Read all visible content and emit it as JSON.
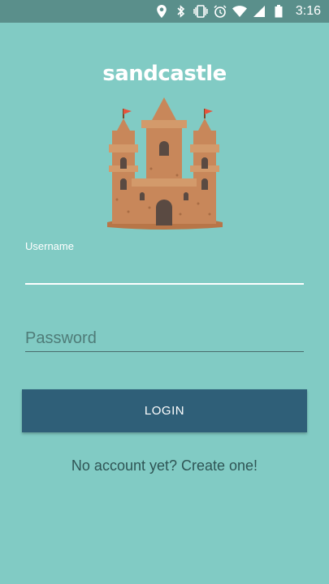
{
  "status_bar": {
    "time": "3:16",
    "icons": [
      "location-icon",
      "bluetooth-icon",
      "vibrate-icon",
      "alarm-icon",
      "wifi-icon",
      "signal-icon",
      "battery-icon"
    ]
  },
  "app": {
    "title": "sandcastle",
    "logo": "sandcastle-logo"
  },
  "form": {
    "username_label": "Username",
    "username_value": "",
    "password_placeholder": "Password",
    "password_value": "",
    "login_label": "LOGIN",
    "signup_text": "No account yet? Create one!"
  },
  "colors": {
    "background": "#81cbc4",
    "status_bar": "#5a8f8b",
    "button": "#2f5f78",
    "castle": "#c8875a",
    "flag": "#e8533c"
  }
}
